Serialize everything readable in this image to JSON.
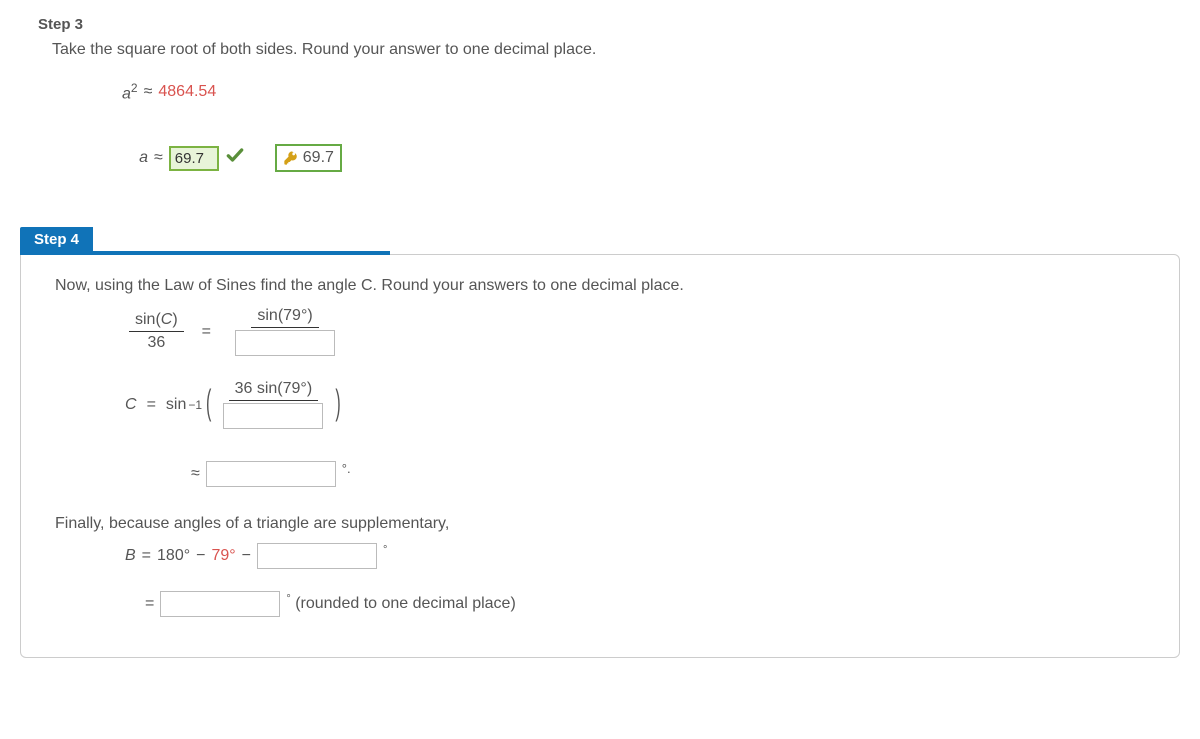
{
  "step3": {
    "header": "Step 3",
    "instruction": "Take the square root of both sides. Round your answer to one decimal place.",
    "eq1": {
      "lhs_var": "a",
      "lhs_exp": "2",
      "approx": "≈",
      "rhs": "4864.54"
    },
    "eq2": {
      "lhs_var": "a",
      "approx": "≈",
      "input_value": "69.7",
      "answer_value": "69.7"
    }
  },
  "step4": {
    "header": "Step 4",
    "instruction": "Now, using the Law of Sines find the angle C. Round your answers to one decimal place.",
    "frac1": {
      "num": "sin(C)",
      "den": "36"
    },
    "eq": "=",
    "frac2": {
      "num": "sin(79°)"
    },
    "arcsin": {
      "C": "C",
      "eq": "=",
      "sin": "sin",
      "neg1": "−1",
      "inner_num": "36 sin(79°)"
    },
    "approx_sym": "≈",
    "deg_period": "°.",
    "supplementary_text": "Finally, because angles of a triangle are supplementary,",
    "b_eq": {
      "B": "B",
      "eq": "=",
      "val1": "180°",
      "minus": "−",
      "val2": "79°",
      "minus2": "−",
      "deg": "°"
    },
    "final": {
      "eq": "=",
      "tail": "° (rounded to one decimal place)"
    }
  }
}
